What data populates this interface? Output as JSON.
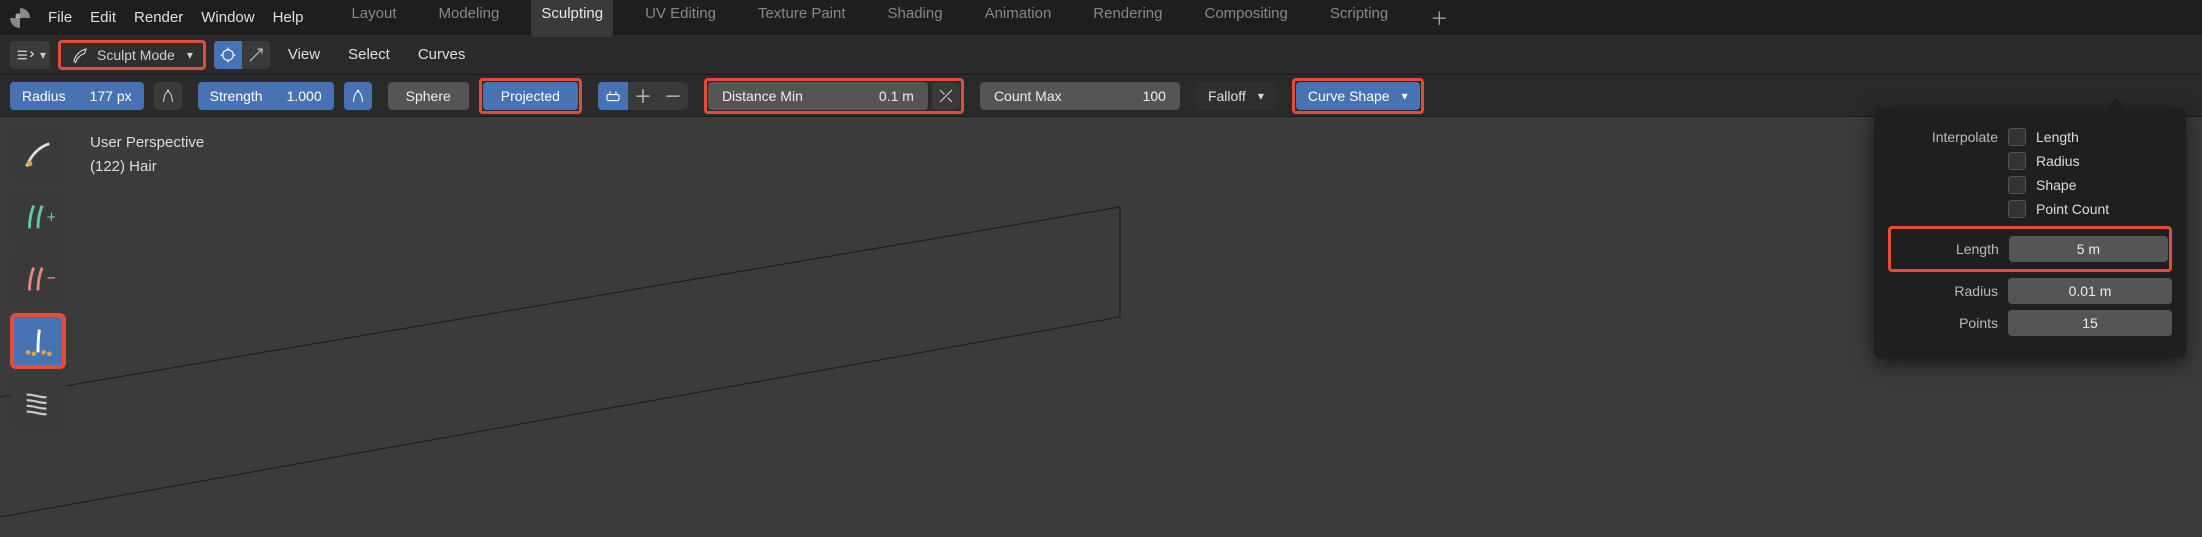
{
  "menu": {
    "file": "File",
    "edit": "Edit",
    "render": "Render",
    "window": "Window",
    "help": "Help"
  },
  "workspaces": {
    "layout": "Layout",
    "modeling": "Modeling",
    "sculpting": "Sculpting",
    "uv": "UV Editing",
    "texpaint": "Texture Paint",
    "shading": "Shading",
    "animation": "Animation",
    "rendering": "Rendering",
    "compositing": "Compositing",
    "scripting": "Scripting"
  },
  "header": {
    "mode": "Sculpt Mode",
    "view": "View",
    "select": "Select",
    "curves": "Curves"
  },
  "toolbar": {
    "radius_label": "Radius",
    "radius_value": "177 px",
    "strength_label": "Strength",
    "strength_value": "1.000",
    "sphere": "Sphere",
    "projected": "Projected",
    "dist_label": "Distance Min",
    "dist_value": "0.1 m",
    "count_label": "Count Max",
    "count_value": "100",
    "falloff": "Falloff",
    "curveshape": "Curve Shape"
  },
  "viewport": {
    "line1": "User Perspective",
    "line2": "(122) Hair"
  },
  "popover": {
    "interpolate": "Interpolate",
    "length_chk": "Length",
    "radius_chk": "Radius",
    "shape_chk": "Shape",
    "pointcount_chk": "Point Count",
    "length_lbl": "Length",
    "length_val": "5 m",
    "radius_lbl": "Radius",
    "radius_val": "0.01 m",
    "points_lbl": "Points",
    "points_val": "15"
  }
}
